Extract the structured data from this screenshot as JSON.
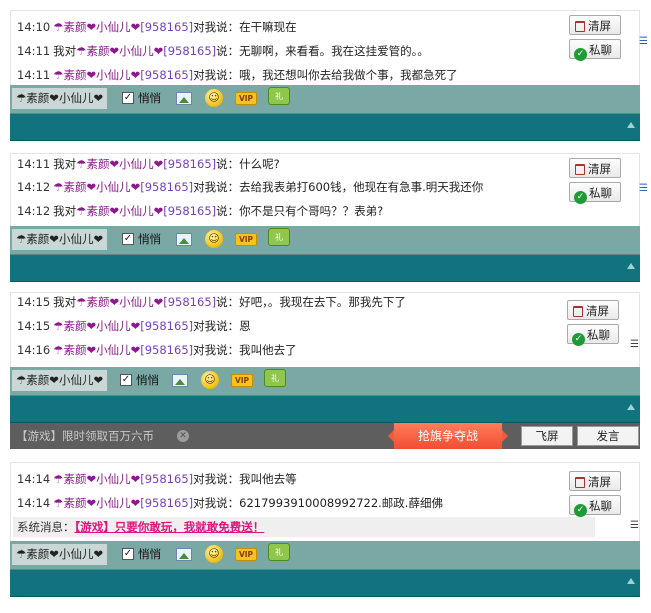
{
  "sidebar_buttons": {
    "clear": "清屏",
    "private": "私聊"
  },
  "toolbar": {
    "quiet_label": "悄悄",
    "vip_label": "VIP",
    "gift_label": "礼"
  },
  "panels": [
    {
      "nick": "☂素颜❤小仙儿❤",
      "messages": [
        {
          "time": "14:10",
          "prefix": "",
          "nick": "☂素颜❤小仙儿❤",
          "id": "[958165]",
          "mid": "对我说：",
          "text": "在干嘛现在"
        },
        {
          "time": "14:11",
          "prefix": "我对",
          "nick": "☂素颜❤小仙儿❤",
          "id": "[958165]",
          "mid": "说：",
          "text": "无聊啊，来看看。我在这挂爱管的。。"
        },
        {
          "time": "14:11",
          "prefix": "",
          "nick": "☂素颜❤小仙儿❤",
          "id": "[958165]",
          "mid": "对我说：",
          "text": "哦，我还想叫你去给我做个事，我都急死了"
        }
      ]
    },
    {
      "nick": "☂素颜❤小仙儿❤",
      "messages": [
        {
          "time": "14:11",
          "prefix": "我对",
          "nick": "☂素颜❤小仙儿❤",
          "id": "[958165]",
          "mid": "说：",
          "text": "什么呢?"
        },
        {
          "time": "14:12",
          "prefix": "",
          "nick": "☂素颜❤小仙儿❤",
          "id": "[958165]",
          "mid": "对我说：",
          "text": "去给我表弟打600钱，他现在有急事.明天我还你"
        },
        {
          "time": "14:12",
          "prefix": "我对",
          "nick": "☂素颜❤小仙儿❤",
          "id": "[958165]",
          "mid": "说：",
          "text": "你不是只有个哥吗？？表弟?"
        }
      ]
    },
    {
      "nick": "☂素颜❤小仙儿❤",
      "messages": [
        {
          "time": "14:15",
          "prefix": "我对",
          "nick": "☂素颜❤小仙儿❤",
          "id": "[958165]",
          "mid": "说：",
          "text": "好吧，。我现在去下。那我先下了"
        },
        {
          "time": "14:15",
          "prefix": "",
          "nick": "☂素颜❤小仙儿❤",
          "id": "[958165]",
          "mid": "对我说：",
          "text": "恩"
        },
        {
          "time": "14:16",
          "prefix": "",
          "nick": "☂素颜❤小仙儿❤",
          "id": "[958165]",
          "mid": "对我说：",
          "text": "我叫他去了"
        }
      ],
      "bottom_bar": {
        "ad_text": "【游戏】限时领取百万六币",
        "game_button": "抢旗争夺战",
        "fly_button": "飞屏",
        "send_button": "发言"
      }
    },
    {
      "nick": "☂素颜❤小仙儿❤",
      "messages": [
        {
          "time": "14:14",
          "prefix": "",
          "nick": "☂素颜❤小仙儿❤",
          "id": "[958165]",
          "mid": "对我说：",
          "text": "我叫他去等"
        },
        {
          "time": "14:14",
          "prefix": "",
          "nick": "☂素颜❤小仙儿❤",
          "id": "[958165]",
          "mid": "对我说：",
          "text": "6217993910008992722.邮政.薛细佛"
        }
      ],
      "system_message": {
        "label": "系统消息：",
        "link_text": "【游戏】只要你敢玩，我就敢免费送！"
      }
    }
  ]
}
